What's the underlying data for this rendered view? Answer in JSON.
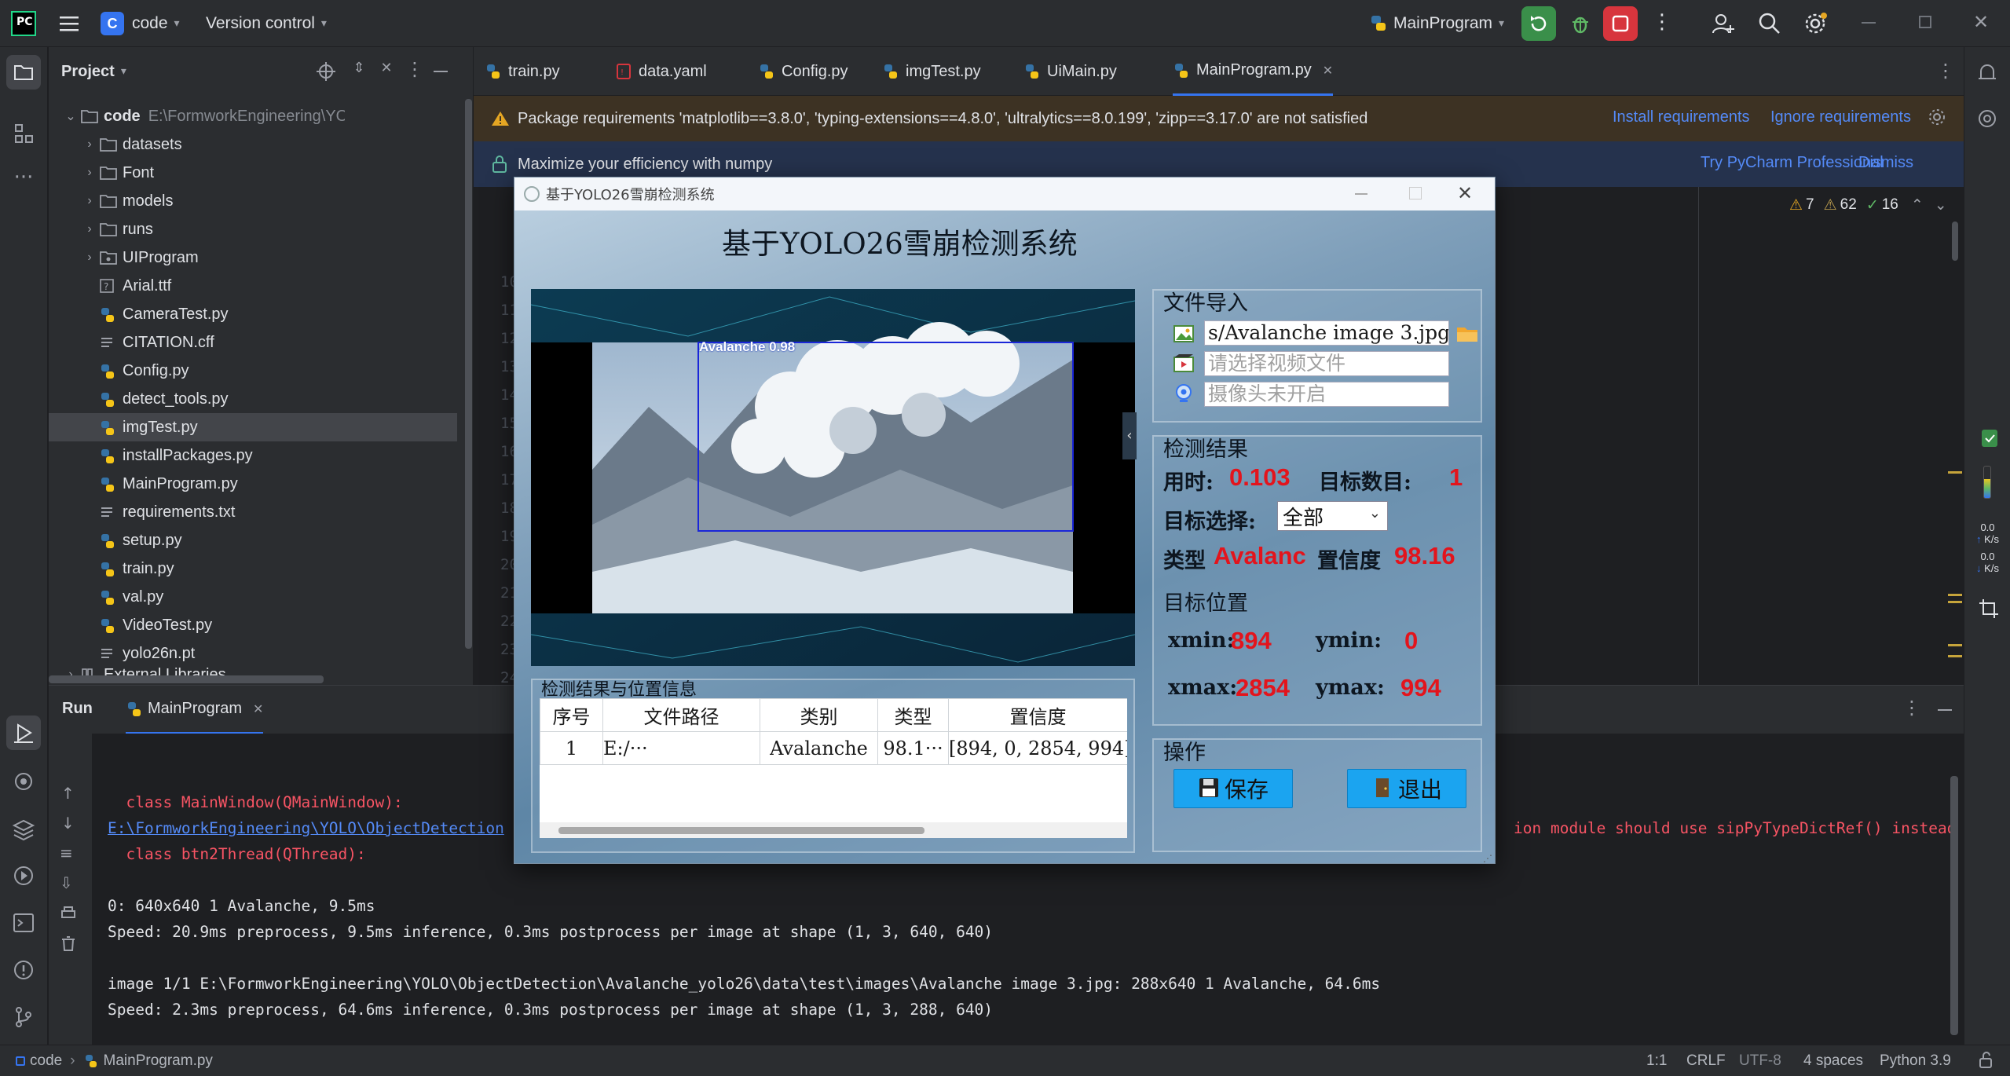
{
  "titlebar": {
    "project_letter": "C",
    "project_name": "code",
    "vcs_label": "Version control",
    "run_config": "MainProgram"
  },
  "project_panel": {
    "title": "Project",
    "root_name": "code",
    "root_path": "E:\\FormworkEngineering\\YOLO\\ObjectDetection",
    "items": [
      {
        "label": "datasets",
        "kind": "folder"
      },
      {
        "label": "Font",
        "kind": "folder"
      },
      {
        "label": "models",
        "kind": "folder"
      },
      {
        "label": "runs",
        "kind": "folder"
      },
      {
        "label": "UIProgram",
        "kind": "package"
      },
      {
        "label": "Arial.ttf",
        "kind": "font"
      },
      {
        "label": "CameraTest.py",
        "kind": "python"
      },
      {
        "label": "CITATION.cff",
        "kind": "text"
      },
      {
        "label": "Config.py",
        "kind": "python"
      },
      {
        "label": "detect_tools.py",
        "kind": "python"
      },
      {
        "label": "imgTest.py",
        "kind": "python",
        "selected": true
      },
      {
        "label": "installPackages.py",
        "kind": "python"
      },
      {
        "label": "MainProgram.py",
        "kind": "python"
      },
      {
        "label": "requirements.txt",
        "kind": "text"
      },
      {
        "label": "setup.py",
        "kind": "python"
      },
      {
        "label": "train.py",
        "kind": "python"
      },
      {
        "label": "val.py",
        "kind": "python"
      },
      {
        "label": "VideoTest.py",
        "kind": "python"
      },
      {
        "label": "yolo26n.pt",
        "kind": "text"
      }
    ],
    "external_libraries": "External Libraries"
  },
  "editor": {
    "tabs": [
      {
        "label": "train.py",
        "icon": "python-icon"
      },
      {
        "label": "data.yaml",
        "icon": "yaml-icon"
      },
      {
        "label": "Config.py",
        "icon": "python-icon"
      },
      {
        "label": "imgTest.py",
        "icon": "python-icon"
      },
      {
        "label": "UiMain.py",
        "icon": "python-icon"
      },
      {
        "label": "MainProgram.py",
        "icon": "python-icon",
        "active": true
      }
    ],
    "banner_requirements": "Package requirements 'matplotlib==3.8.0', 'typing-extensions==4.8.0', 'ultralytics==8.0.199', 'zipp==3.17.0' are not satisfied",
    "install_requirements": "Install requirements",
    "ignore_requirements": "Ignore requirements",
    "banner_numpy": "Maximize your efficiency with numpy",
    "try_pro": "Try PyCharm Professional",
    "dismiss": "Dismiss",
    "inspections": {
      "warnings": "7",
      "weak_warnings": "62",
      "ok": "16"
    },
    "line_numbers": [
      "10",
      "11",
      "12",
      "13",
      "14",
      "15",
      "16",
      "17",
      "18",
      "19",
      "20",
      "21",
      "22",
      "23",
      "24"
    ]
  },
  "run_panel": {
    "title": "Run",
    "tab_label": "MainProgram",
    "lines": [
      {
        "text": "  class MainWindow(QMainWindow):",
        "style": "err"
      },
      {
        "text": "E:\\FormworkEngineering\\YOLO\\ObjectDetection",
        "style": "lnk",
        "suffix": "ion module should use sipPyTypeDictRef() instead"
      },
      {
        "text": "  class btn2Thread(QThread):",
        "style": "err"
      },
      {
        "text": "",
        "style": "out"
      },
      {
        "text": "0: 640x640 1 Avalanche, 9.5ms",
        "style": "out"
      },
      {
        "text": "Speed: 20.9ms preprocess, 9.5ms inference, 0.3ms postprocess per image at shape (1, 3, 640, 640)",
        "style": "out"
      },
      {
        "text": "",
        "style": "out"
      },
      {
        "text": "image 1/1 E:\\FormworkEngineering\\YOLO\\ObjectDetection\\Avalanche_yolo26\\data\\test\\images\\Avalanche image 3.jpg: 288x640 1 Avalanche, 64.6ms",
        "style": "out"
      },
      {
        "text": "Speed: 2.3ms preprocess, 64.6ms inference, 0.3ms postprocess per image at shape (1, 3, 288, 640)",
        "style": "out"
      }
    ]
  },
  "statusbar": {
    "crumb_project": "code",
    "crumb_file": "MainProgram.py",
    "position": "1:1",
    "line_sep": "CRLF",
    "encoding": "UTF-8",
    "indent": "4 spaces",
    "interpreter": "Python 3.9"
  },
  "right_strip": {
    "up_speed": "0.0",
    "up_unit": "K/s",
    "down_speed": "0.0",
    "down_unit": "K/s"
  },
  "app": {
    "window_title": "基于YOLO26雪崩检测系统",
    "heading": "基于YOLO26雪崩检测系统",
    "detection_label": "Avalanche  0.98",
    "file_import": {
      "title": "文件导入",
      "image_path": "s/Avalanche image 3.jpg",
      "video_placeholder": "请选择视频文件",
      "camera_placeholder": "摄像头未开启"
    },
    "results": {
      "title": "检测结果",
      "time_label": "用时:",
      "time_value": "0.103",
      "count_label": "目标数目:",
      "count_value": "1",
      "select_label": "目标选择:",
      "select_value": "全部",
      "type_label": "类型",
      "type_value": "Avalanc",
      "conf_label": "置信度",
      "conf_value": "98.16"
    },
    "position": {
      "title": "目标位置",
      "xmin_label": "xmin:",
      "xmin_value": "894",
      "ymin_label": "ymin:",
      "ymin_value": "0",
      "xmax_label": "xmax:",
      "xmax_value": "2854",
      "ymax_label": "ymax:",
      "ymax_value": "994"
    },
    "table": {
      "title": "检测结果与位置信息",
      "headers": [
        "序号",
        "文件路径",
        "类别",
        "类型",
        "置信度"
      ],
      "rows": [
        [
          "1",
          "E:/···",
          "Avalanche",
          "98.1···",
          "[894, 0, 2854, 994]"
        ]
      ]
    },
    "operations": {
      "title": "操作",
      "save": "保存",
      "exit": "退出"
    }
  },
  "colors": {
    "accent": "#3574f0",
    "danger": "#e3141c",
    "app_button": "#1ba4f0",
    "run_green": "#3a8f4a",
    "stop_red": "#d7353d"
  }
}
